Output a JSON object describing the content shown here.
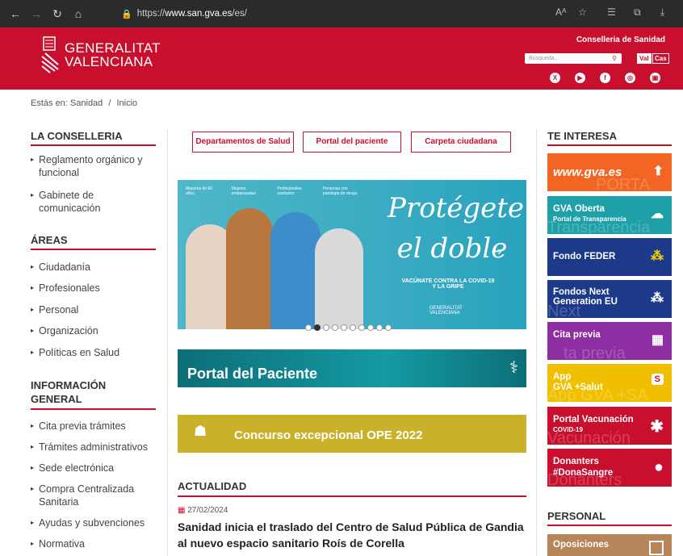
{
  "browser": {
    "url_prefix": "https://",
    "url_domain": "www.san.gva.es",
    "url_path": "/es/",
    "reader_icon": "Aᴬ"
  },
  "header": {
    "logo_line1": "GENERALITAT",
    "logo_line2": "VALENCIANA",
    "conselleria": "Conselleria de Sanidad",
    "search_placeholder": "Búsqueda...",
    "lang_val": "Val",
    "lang_cas": "Cas",
    "socials": [
      "X",
      "▶",
      "f",
      "◎",
      "▣"
    ]
  },
  "breadcrumb": {
    "prefix": "Estás en:",
    "home": "Sanidad",
    "sep": "/",
    "current": "Inicio"
  },
  "left": {
    "la_conselleria": {
      "title": "LA CONSELLERIA",
      "items": [
        "Reglamento orgánico y funcional",
        "Gabinete de comunicación"
      ]
    },
    "areas": {
      "title": "ÁREAS",
      "items": [
        "Ciudadanía",
        "Profesionales",
        "Personal",
        "Organización",
        "Políticas en Salud"
      ]
    },
    "info": {
      "title": "INFORMACIÓN GENERAL",
      "items": [
        "Cita previa trámites",
        "Trámites administrativos",
        "Sede electrónica",
        "Compra Centralizada Sanitaria",
        "Ayudas y subvenciones",
        "Normativa"
      ]
    }
  },
  "center": {
    "buttons": [
      "Departamentos de Salud",
      "Portal del paciente",
      "Carpeta ciudadana"
    ],
    "hero": {
      "title_line1": "Protégete",
      "title_line2": "el doble",
      "sub": "VACÚNATE CONTRA LA COVID-19 Y LA GRIPE",
      "logo": "GENERALITAT VALENCIANA",
      "icons": [
        "Mayores de 60 años",
        "Mujeres embarazadas",
        "Profesionales sanitarios",
        "Personas con patología de riesgo"
      ]
    },
    "portal": "Portal del Paciente",
    "ope": "Concurso excepcional OPE 2022",
    "actualidad": "ACTUALIDAD",
    "news_date": "27/02/2024",
    "news_title": "Sanidad inicia el traslado del Centro de Salud Pública de Gandia al nuevo espacio sanitario Roís de Corella"
  },
  "right": {
    "title": "TE INTERESA",
    "cards": [
      {
        "l1": "www.gva.es",
        "l2": "",
        "ghost": "PORTA",
        "bg": "#f26522",
        "icon": "⬆"
      },
      {
        "l1": "GVA Oberta",
        "l2": "Portal de Transparencia",
        "ghost": "Transparencia",
        "bg": "#1fa0a8",
        "icon": "☁"
      },
      {
        "l1": "Fondo FEDER",
        "l2": "",
        "ghost": "",
        "bg": "#1d3a8a",
        "icon": "⁂"
      },
      {
        "l1": "Fondos Next",
        "l2": "Generation EU",
        "ghost": "Next",
        "bg": "#1d3a8a",
        "icon": "⁂"
      },
      {
        "l1": "Cita previa",
        "l2": "",
        "ghost": "ta previa",
        "bg": "#8e2ea3",
        "icon": "▦"
      },
      {
        "l1": "App",
        "l2": "GVA +Salut",
        "ghost": "App GVA +SA",
        "bg": "#f0c000",
        "icon": "S"
      },
      {
        "l1": "Portal Vacunación",
        "l2": "COVID-19",
        "ghost": "Vacunación",
        "bg": "#c8102e",
        "icon": "✱"
      },
      {
        "l1": "Donanters",
        "l2": "#DonaSangre",
        "ghost": "Donanters",
        "bg": "#c8102e",
        "icon": "●"
      }
    ],
    "personal_title": "PERSONAL",
    "personal_card": "Oposiciones"
  }
}
